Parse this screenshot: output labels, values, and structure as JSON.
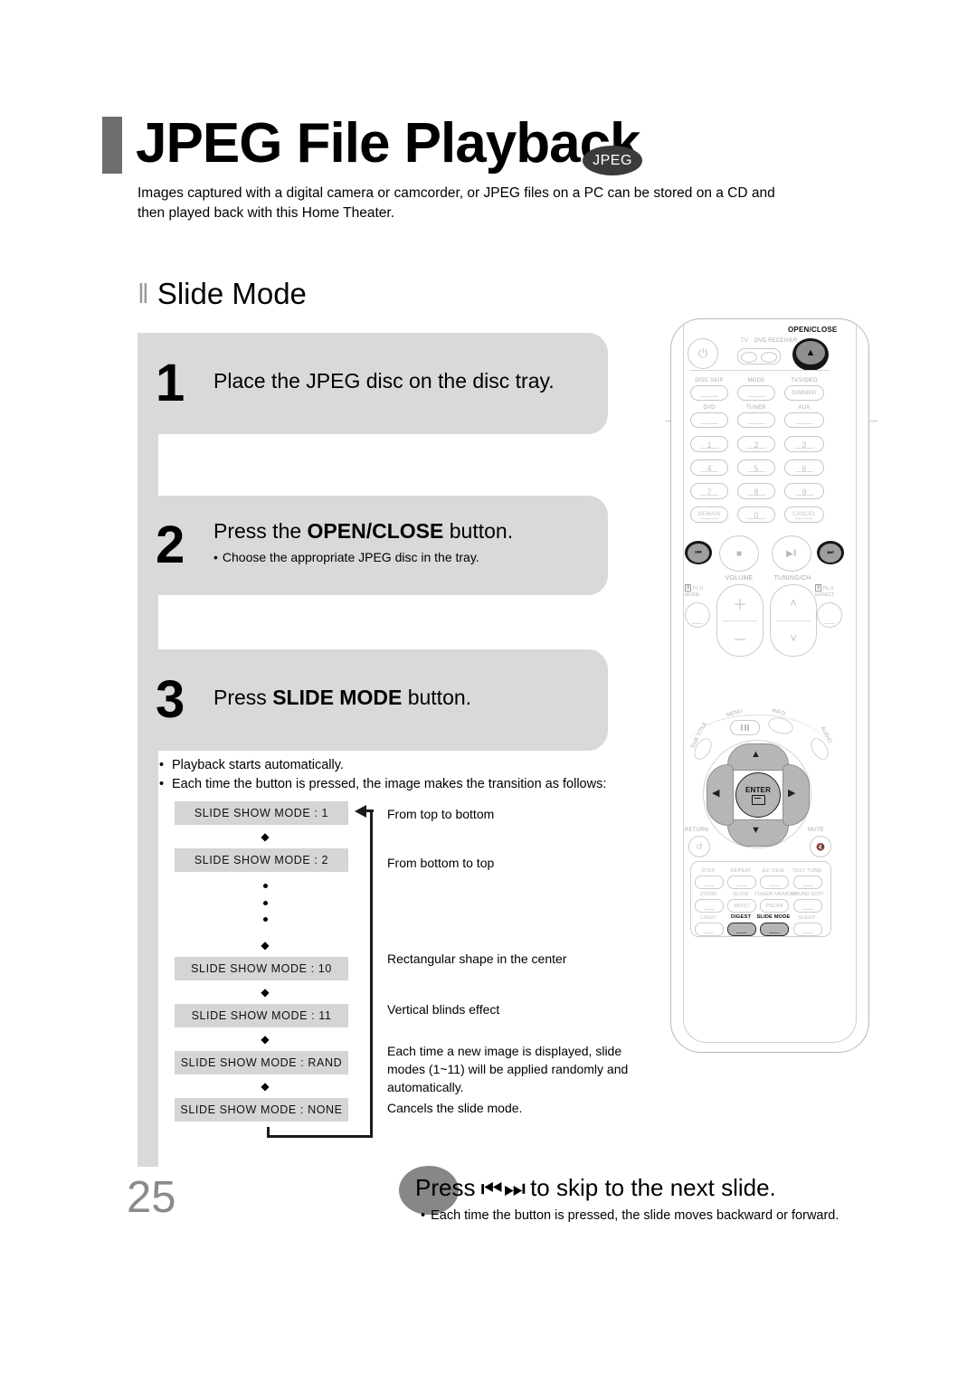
{
  "header": {
    "title": "JPEG File Playback",
    "badge": "JPEG",
    "intro": "Images captured with a digital camera or camcorder, or JPEG files on a PC can be stored on a CD and then played back with this Home Theater."
  },
  "section": {
    "heading": "Slide Mode",
    "heading_bars": "‖"
  },
  "steps": [
    {
      "number": "1",
      "title": "Place the JPEG disc on the disc tray.",
      "sub": ""
    },
    {
      "number": "2",
      "title_pre": "Press the ",
      "title_bold": "OPEN/CLOSE",
      "title_post": " button.",
      "sub": "Choose the appropriate JPEG disc in the tray."
    },
    {
      "number": "3",
      "title_pre": "Press ",
      "title_bold": "SLIDE MODE",
      "title_post": " button.",
      "sub": ""
    }
  ],
  "notes": [
    "Playback starts automatically.",
    "Each time the button is pressed, the image makes the transition as follows:"
  ],
  "bullet_char": "•",
  "flow": {
    "arrow_char": "◆",
    "boxes": [
      {
        "label": "SLIDE SHOW MODE : 1",
        "desc": "From top to bottom"
      },
      {
        "label": "SLIDE SHOW MODE : 2",
        "desc": "From bottom to top"
      },
      {
        "label": "SLIDE SHOW MODE : 10",
        "desc": "Rectangular shape in the center"
      },
      {
        "label": "SLIDE SHOW MODE : 11",
        "desc": "Vertical blinds effect"
      },
      {
        "label": "SLIDE SHOW MODE : RAND",
        "desc": "Each time a new image is displayed, slide modes (1~11) will be applied randomly and automatically."
      },
      {
        "label": "SLIDE SHOW MODE : NONE",
        "desc": "Cancels the slide mode."
      }
    ]
  },
  "footer": {
    "press_pre": "Press",
    "skip_icons": "⏮⏭",
    "press_post": "to skip to the next slide.",
    "note": "Each time the button is pressed, the slide moves backward or forward.",
    "page_number": "25"
  },
  "remote": {
    "labels": {
      "open_close": "OPEN/CLOSE",
      "tv": "TV",
      "dvd_receiver": "DVD RECEIVER",
      "disc_skip": "DISC SKIP",
      "mode": "MODE",
      "tv_video": "TV/VIDEO",
      "dimmer": "DIMMER",
      "dvd": "DVD",
      "tuner": "TUNER",
      "aux": "AUX",
      "remain": "REMAIN",
      "cancel": "CANCEL",
      "volume": "VOLUME",
      "tuning_ch": "TUNING/CH",
      "pl2_mode_1": "PL II",
      "pl2_mode_2": "MODE",
      "pl2_effect_1": "PL II",
      "pl2_effect_2": "EFFECT",
      "menu": "MENU",
      "info": "INFO",
      "subtitle": "SUB TITLE",
      "audio": "AUDIO",
      "enter": "ENTER",
      "return": "RETURN",
      "mute": "MUTE",
      "step": "STEP",
      "repeat": "REPEAT",
      "ez_view": "EZ VIEW",
      "test_tone": "TEST TONE",
      "zoom": "ZOOM",
      "slow": "SLOW",
      "mo_st": "MO/ST",
      "tuner_memory": "TUNER MEMORY",
      "pscan": "PSCAN",
      "sound_edit": "SOUND EDIT",
      "logo": "LOGO",
      "digest": "DIGEST",
      "slide_mode": "SLIDE MODE",
      "sleep": "SLEEP"
    },
    "numbers": [
      "1",
      "2",
      "3",
      "4",
      "5",
      "6",
      "7",
      "8",
      "9",
      "0"
    ],
    "glyphs": {
      "power": "⏻",
      "eject": "▲",
      "prev": "⏮",
      "stop": "■",
      "play_pause": "▶‖",
      "next": "⏭",
      "plus": "＋",
      "minus": "－",
      "up": "˄",
      "down": "˅",
      "return": "↺",
      "mute": "🔇",
      "nav_up": "▲",
      "nav_down": "▼",
      "nav_left": "◀",
      "nav_right": "▶"
    }
  },
  "colors": {
    "accent_bar": "#6e6e6e",
    "panel": "#d9d9d9",
    "flow_box": "#d5d5d5",
    "page_number": "#8a8a8a",
    "badge_bg": "#3b3b3b"
  }
}
